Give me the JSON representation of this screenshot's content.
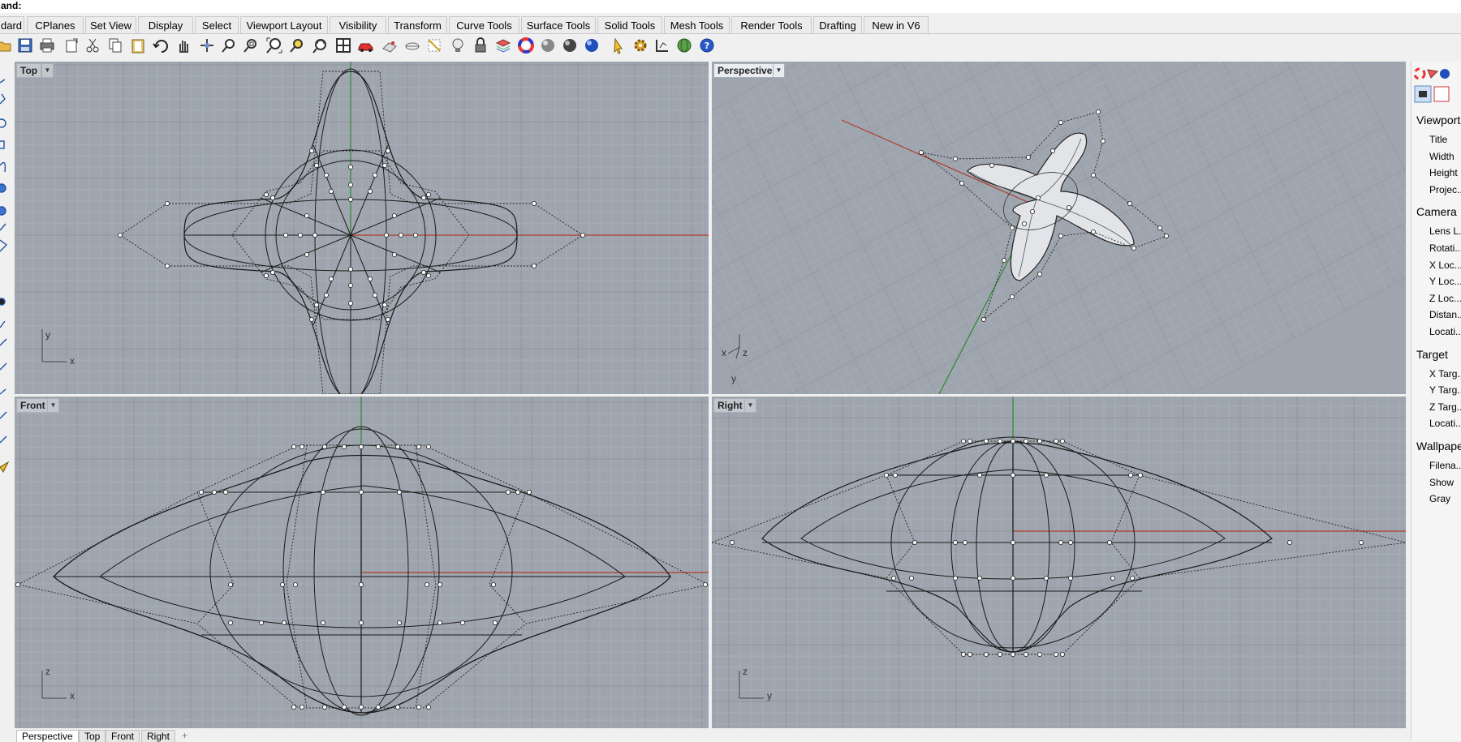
{
  "command_prompt": "and:",
  "tabs": [
    "dard",
    "CPlanes",
    "Set View",
    "Display",
    "Select",
    "Viewport Layout",
    "Visibility",
    "Transform",
    "Curve Tools",
    "Surface Tools",
    "Solid Tools",
    "Mesh Tools",
    "Render Tools",
    "Drafting",
    "New in V6"
  ],
  "toolbar_icons": [
    "open-icon",
    "save-icon",
    "print-icon",
    "import-icon",
    "cut-icon",
    "copy-icon",
    "paste-icon",
    "undo-icon",
    "pan-hand-icon",
    "rotate-view-icon",
    "zoom-icon",
    "zoom-window-icon",
    "zoom-extents-icon",
    "zoom-selected-icon",
    "rotate-zoom-icon",
    "four-viewports-icon",
    "car-icon",
    "named-view-icon",
    "cplane-icon",
    "grid-snap-icon",
    "light-bulb-icon",
    "lock-icon",
    "layer-icon",
    "color-wheel-icon",
    "material-sphere-icon",
    "render-sphere-icon",
    "environment-sphere-icon",
    "pointer-icon",
    "gear-icon",
    "options-icon",
    "globe-icon",
    "help-icon"
  ],
  "viewports": {
    "top": {
      "label": "Top",
      "axes": [
        "y",
        "x"
      ]
    },
    "perspective": {
      "label": "Perspective",
      "axes": [
        "x",
        "z",
        "y"
      ]
    },
    "front": {
      "label": "Front",
      "axes": [
        "z",
        "x"
      ]
    },
    "right": {
      "label": "Right",
      "axes": [
        "z",
        "y"
      ]
    }
  },
  "viewport_tabs": [
    "Perspective",
    "Top",
    "Front",
    "Right"
  ],
  "properties": {
    "sections": [
      {
        "title": "Viewport",
        "items": [
          "Title",
          "Width",
          "Height",
          "Projec..."
        ]
      },
      {
        "title": "Camera",
        "items": [
          "Lens L...",
          "Rotati...",
          "X Loc...",
          "Y Loc...",
          "Z Loc...",
          "Distan...",
          "Locati..."
        ]
      },
      {
        "title": "Target",
        "items": [
          "X Targ...",
          "Y Targ...",
          "Z Targ...",
          "Locati..."
        ]
      },
      {
        "title": "Wallpape",
        "items": [
          "Filena...",
          "Show",
          "Gray"
        ]
      }
    ]
  },
  "colors": {
    "viewport_bg": "#9ea5ae",
    "x_axis": "#b23a2a",
    "y_axis": "#2d8a2d",
    "curve": "#1a1a1a"
  }
}
